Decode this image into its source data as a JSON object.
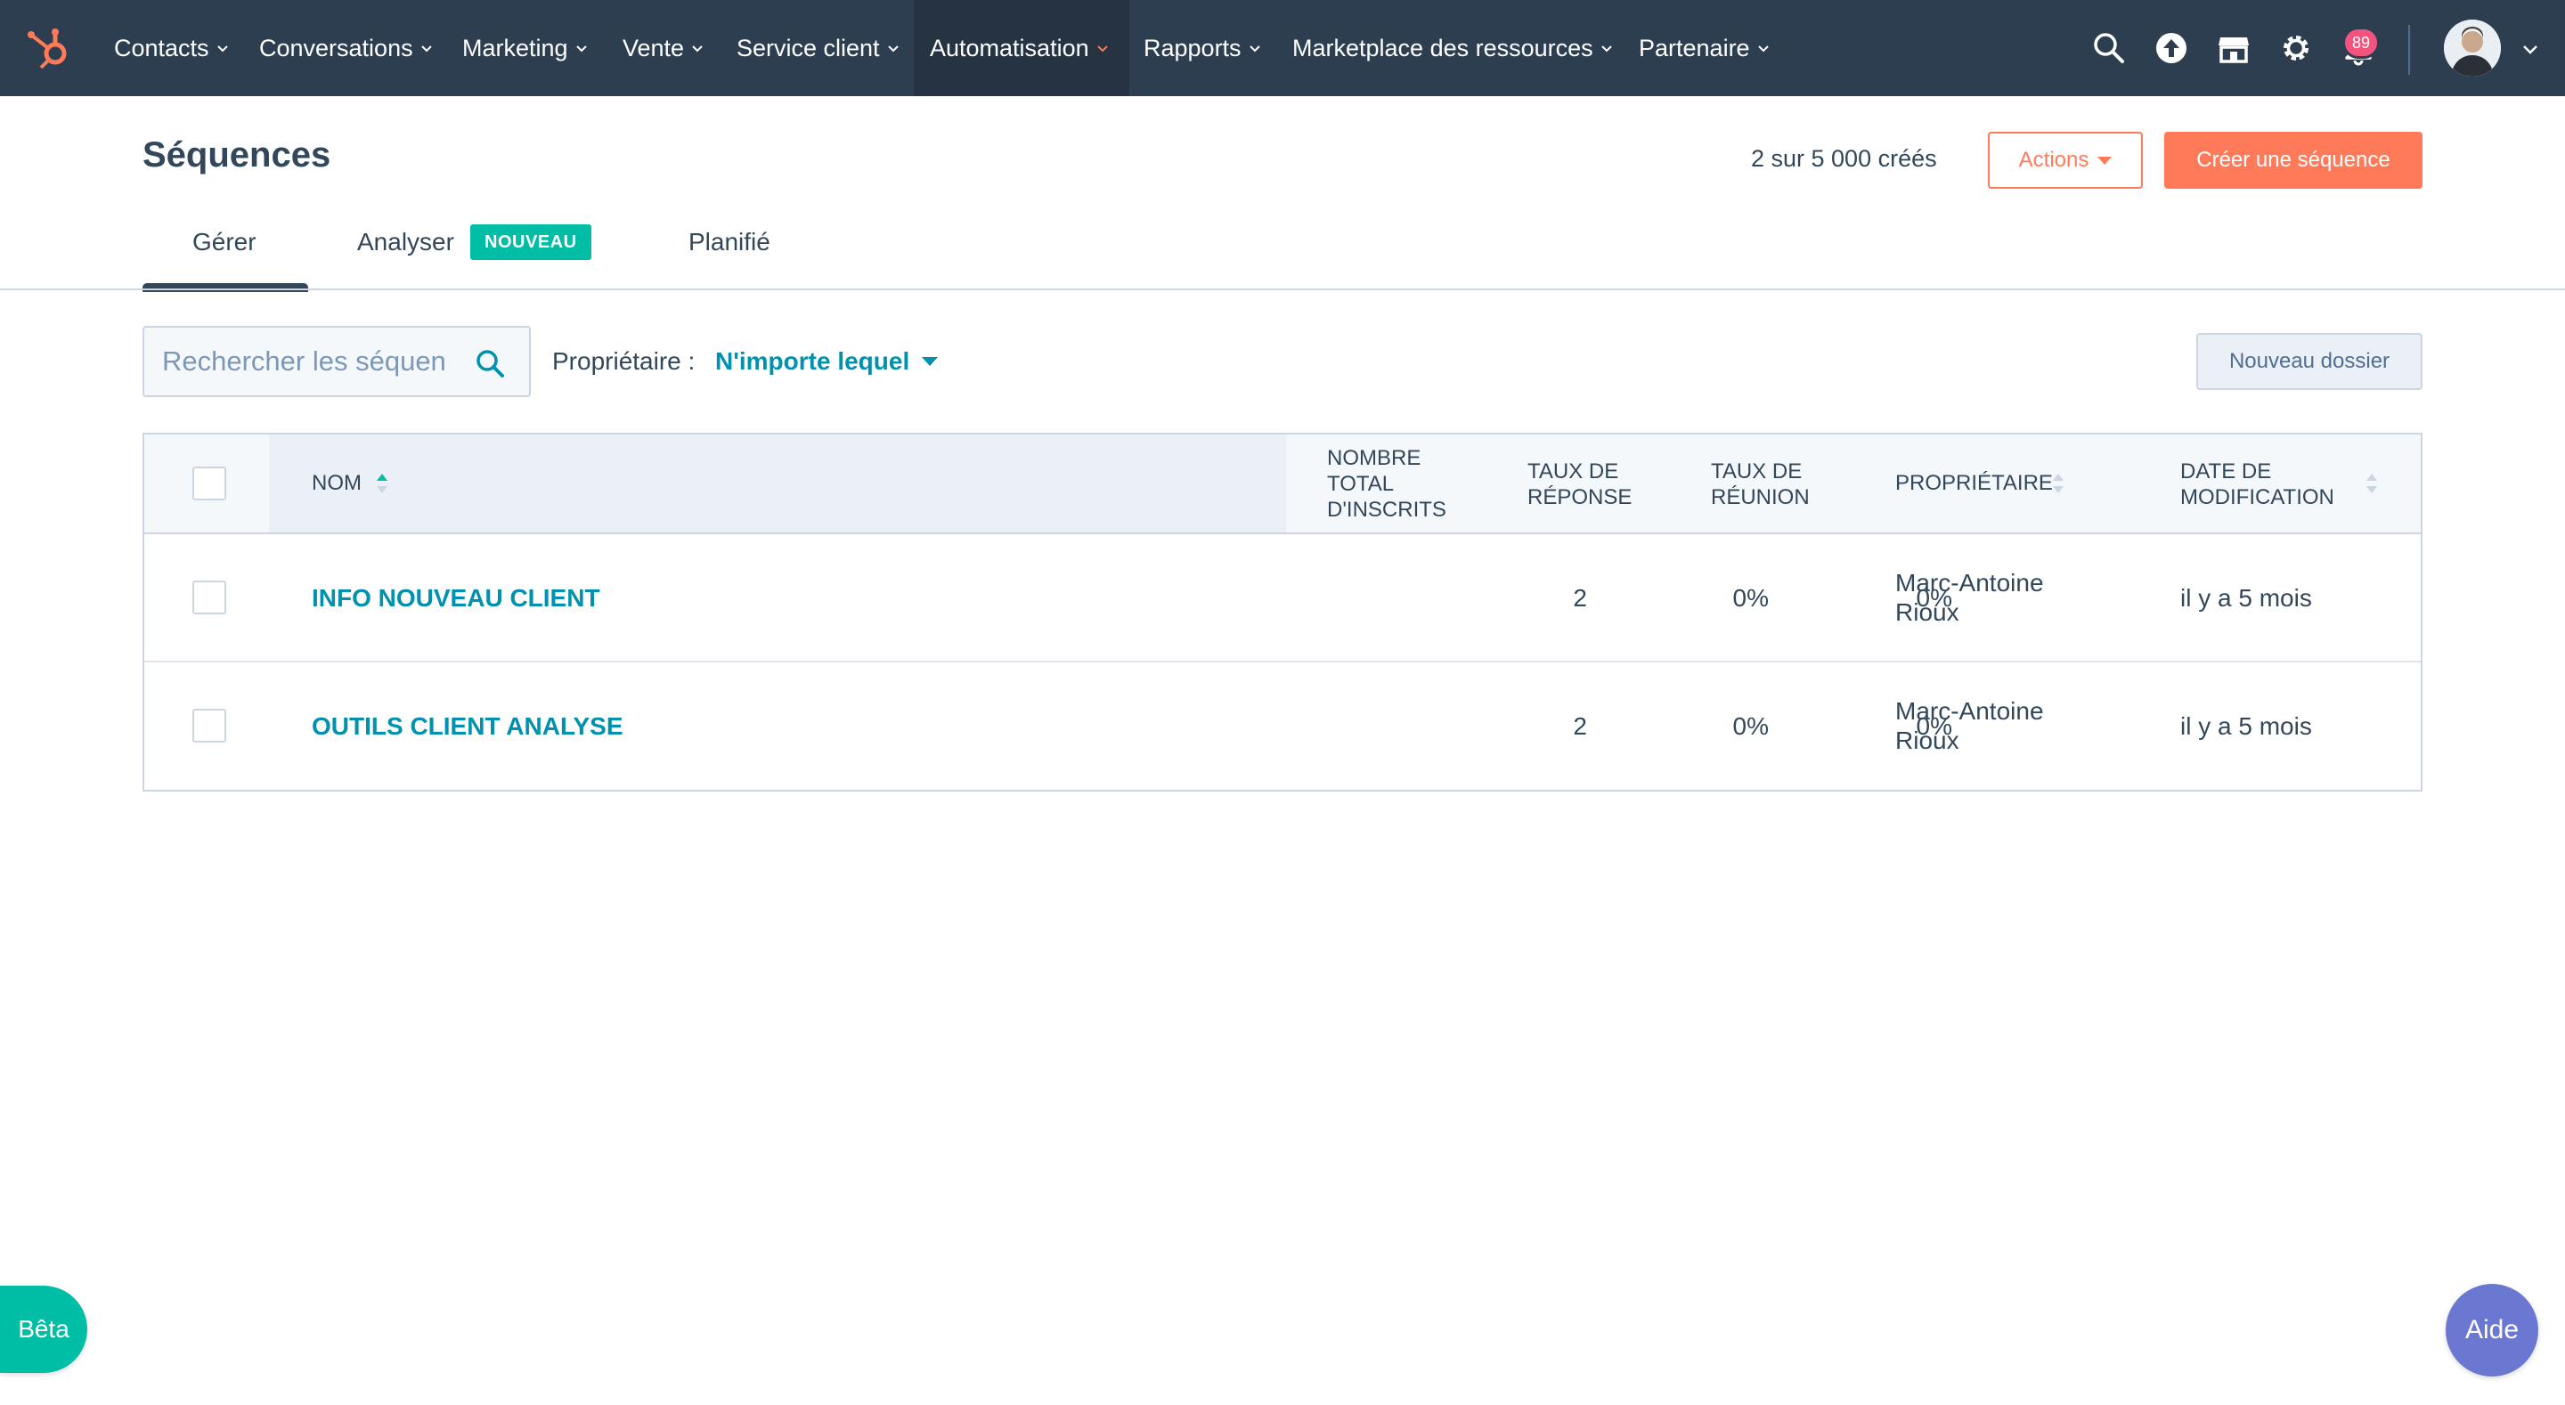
{
  "nav": {
    "items": [
      {
        "label": "Contacts",
        "active": false
      },
      {
        "label": "Conversations",
        "active": false
      },
      {
        "label": "Marketing",
        "active": false
      },
      {
        "label": "Vente",
        "active": false
      },
      {
        "label": "Service client",
        "active": false
      },
      {
        "label": "Automatisation",
        "active": true
      },
      {
        "label": "Rapports",
        "active": false
      },
      {
        "label": "Marketplace des ressources",
        "active": false
      },
      {
        "label": "Partenaire",
        "active": false
      }
    ],
    "icons": [
      "search-icon",
      "upgrade-icon",
      "marketplace-icon",
      "settings-icon",
      "notifications-icon"
    ],
    "notification_count": "89",
    "colors": {
      "bar": "#2d3e50",
      "active": "#253342",
      "accent": "#ff7a59",
      "badge": "#f2547d"
    }
  },
  "header": {
    "title": "Séquences",
    "created_count": "2 sur 5 000 créés",
    "actions_label": "Actions",
    "create_label": "Créer une séquence"
  },
  "tabs": [
    {
      "label": "Gérer",
      "active": true
    },
    {
      "label": "Analyser",
      "active": false,
      "badge": "NOUVEAU"
    },
    {
      "label": "Planifié",
      "active": false
    }
  ],
  "filters": {
    "search_placeholder": "Rechercher les séquences",
    "owner_label": "Propriétaire :",
    "owner_value": "N'importe lequel",
    "new_folder_label": "Nouveau dossier"
  },
  "table": {
    "columns": {
      "name": "NOM",
      "enrolled": [
        "NOMBRE",
        "TOTAL",
        "D'INSCRITS"
      ],
      "reply": [
        "TAUX DE",
        "RÉPONSE"
      ],
      "meeting": [
        "TAUX DE",
        "RÉUNION"
      ],
      "owner": "PROPRIÉTAIRE",
      "modified": [
        "DATE DE",
        "MODIFICATION"
      ]
    },
    "rows": [
      {
        "name": "INFO NOUVEAU CLIENT",
        "enrolled": "2",
        "reply": "0%",
        "meeting": "0%",
        "owner": [
          "Marc-Antoine",
          "Rioux"
        ],
        "modified": "il y a 5 mois"
      },
      {
        "name": "OUTILS CLIENT ANALYSE",
        "enrolled": "2",
        "reply": "0%",
        "meeting": "0%",
        "owner": [
          "Marc-Antoine",
          "Rioux"
        ],
        "modified": "il y a 5 mois"
      }
    ]
  },
  "floating": {
    "beta_label": "Bêta",
    "help_label": "Aide"
  }
}
